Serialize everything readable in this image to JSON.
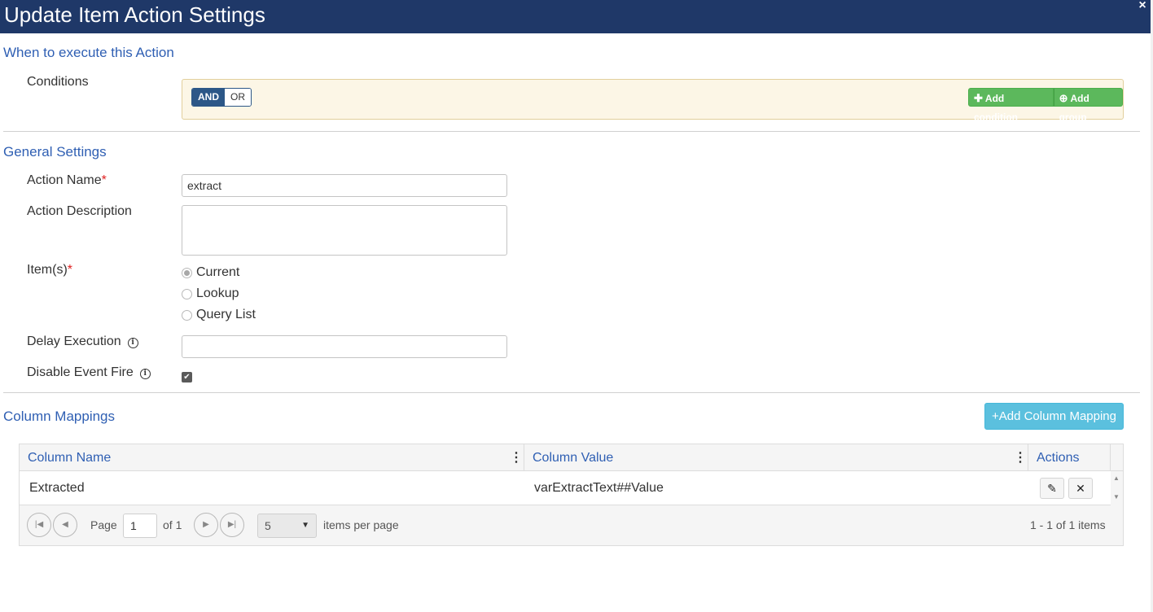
{
  "dialog": {
    "title": "Update Item Action Settings",
    "close_glyph": "×"
  },
  "when": {
    "heading": "When to execute this Action",
    "conditions_label": "Conditions",
    "and_label": "AND",
    "or_label": "OR",
    "add_condition_label": "Add condition",
    "add_group_label": "Add group"
  },
  "general": {
    "heading": "General Settings",
    "action_name_label": "Action Name",
    "action_name_value": "extract",
    "action_description_label": "Action Description",
    "action_description_value": "",
    "items_label": "Item(s)",
    "items_options": [
      "Current",
      "Lookup",
      "Query List"
    ],
    "items_selected": "Current",
    "delay_label": "Delay Execution",
    "delay_value": "",
    "disable_event_label": "Disable Event Fire",
    "disable_event_checked": true,
    "required_marker": "*"
  },
  "mappings": {
    "heading": "Column Mappings",
    "add_button_label": "+Add Column Mapping",
    "columns": [
      "Column Name",
      "Column Value",
      "Actions"
    ],
    "rows": [
      {
        "column_name": "Extracted",
        "column_value": "varExtractText##Value"
      }
    ],
    "pager": {
      "page_label": "Page",
      "page_value": "1",
      "of_label": "of 1",
      "page_size": "5",
      "per_page_label": "items per page",
      "summary": "1 - 1 of 1 items"
    }
  },
  "icons": [
    "close-icon",
    "plus-icon",
    "plus-circle-icon",
    "info-icon",
    "kebab-icon",
    "pencil-icon",
    "delete-x-icon",
    "first-page-icon",
    "prev-page-icon",
    "next-page-icon",
    "last-page-icon",
    "dropdown-arrow-icon"
  ],
  "colors": {
    "title_bar": "#1f3868",
    "section_heading": "#2f5fb3",
    "and_active": "#2c5787",
    "green_button": "#5cb85c",
    "info_button": "#5bc0de",
    "conditions_bg": "#fcf6e6"
  }
}
